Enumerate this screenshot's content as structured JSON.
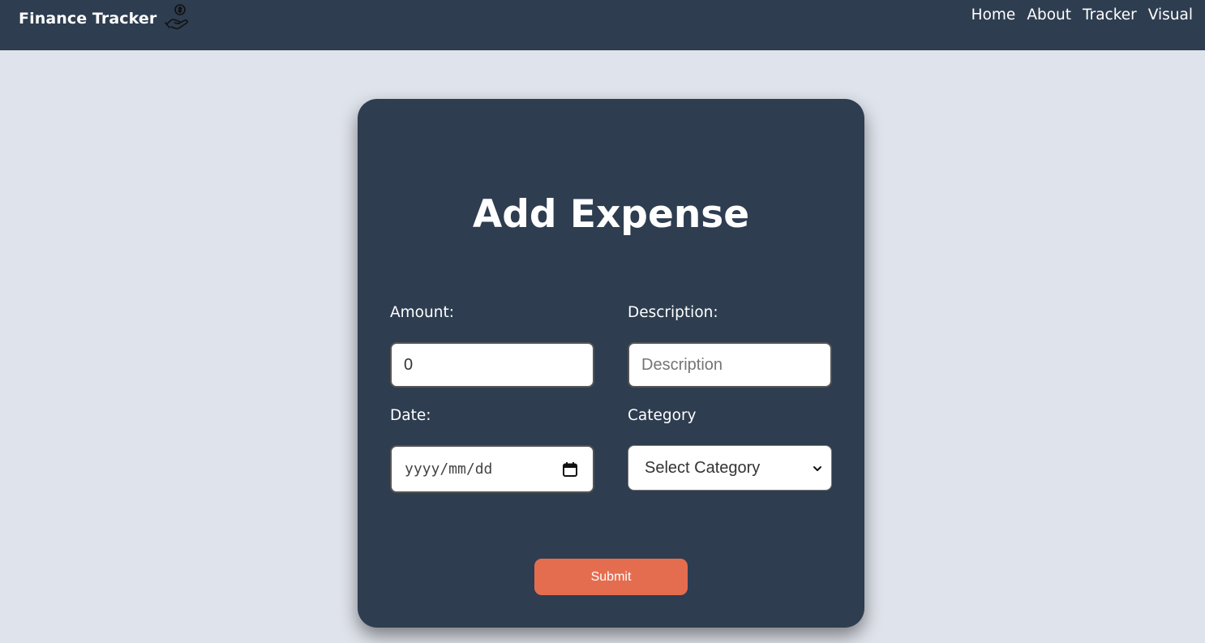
{
  "navbar": {
    "brand": "Finance Tracker",
    "brand_icon": "hand-coin-icon",
    "links": [
      {
        "label": "Home"
      },
      {
        "label": "About"
      },
      {
        "label": "Tracker"
      },
      {
        "label": "Visual"
      }
    ]
  },
  "form": {
    "title": "Add Expense",
    "amount": {
      "label": "Amount:",
      "value": "0"
    },
    "description": {
      "label": "Description:",
      "value": "",
      "placeholder": "Description"
    },
    "date": {
      "label": "Date:",
      "display": "yyyy/mm/dd",
      "icon": "calendar-icon"
    },
    "category": {
      "label": "Category",
      "selected": "Select Category",
      "icon": "chevron-down-icon"
    },
    "submit_label": "Submit"
  },
  "colors": {
    "background": "#dfe3eb",
    "navbar": "#2e3d50",
    "card": "#2e3d50",
    "accent": "#e56d4f",
    "text": "#ffffff"
  }
}
